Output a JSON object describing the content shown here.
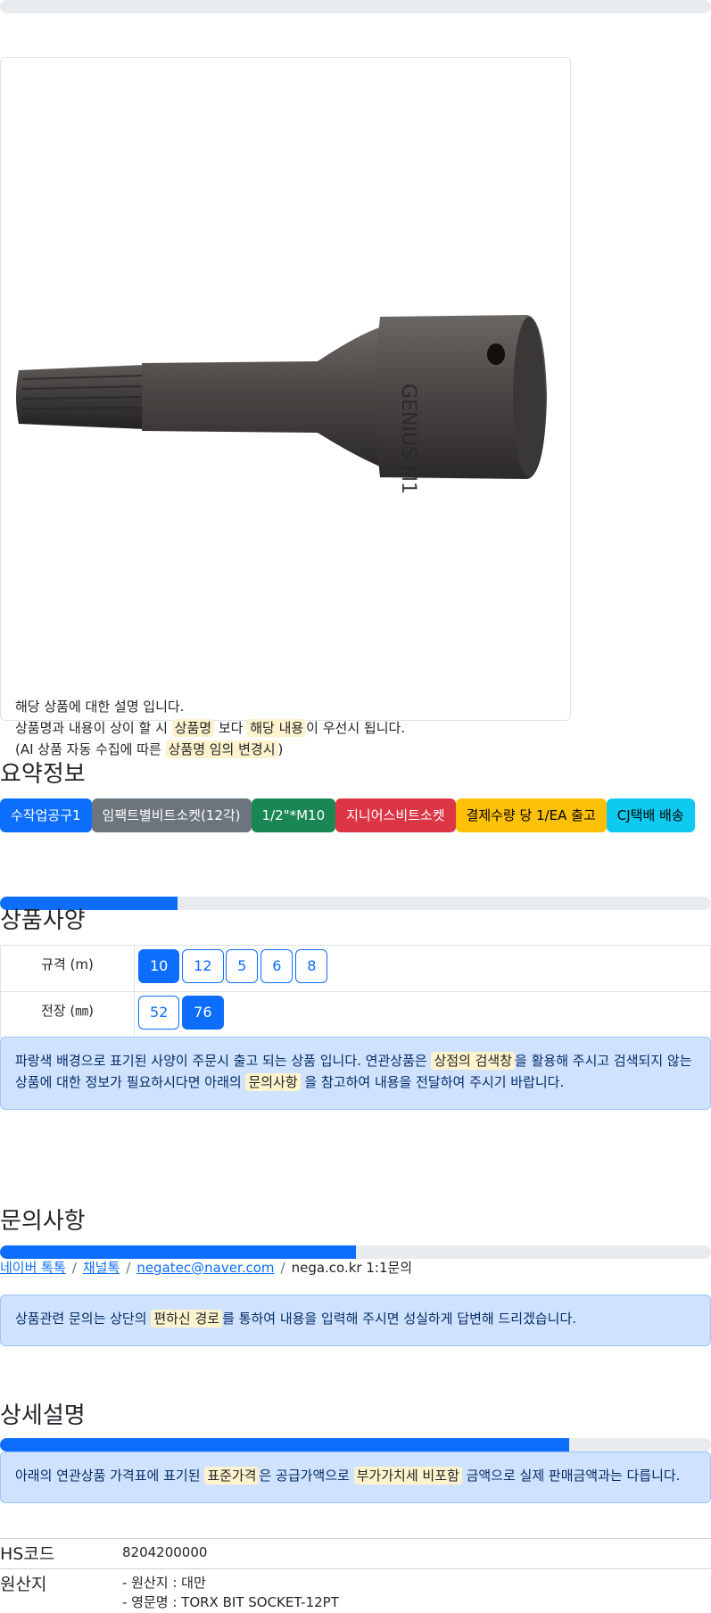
{
  "product": {
    "description_lines": [
      {
        "parts": [
          {
            "text": "해당 상품에 대한 설명 입니다."
          }
        ]
      },
      {
        "parts": [
          {
            "text": "상품명과 내용이 상이 할 시 "
          },
          {
            "text": "상품명",
            "hl": true
          },
          {
            "text": " 보다 "
          },
          {
            "text": "해당 내용",
            "hl": true
          },
          {
            "text": "이 우선시 됩니다."
          }
        ]
      },
      {
        "parts": [
          {
            "text": "(AI 상품 자동 수집에 따른 "
          },
          {
            "text": "상품명 임의 변경시",
            "hl": true
          },
          {
            "text": ")"
          }
        ]
      }
    ]
  },
  "summary": {
    "title": "요약정보",
    "badges": [
      {
        "label": "수작업공구1",
        "bg": "#0d6efd",
        "fg": "#ffffff"
      },
      {
        "label": "임팩트별비트소켓(12각)",
        "bg": "#6c757d",
        "fg": "#ffffff"
      },
      {
        "label": "1/2\"*M10",
        "bg": "#198754",
        "fg": "#ffffff"
      },
      {
        "label": "지니어스비트소켓",
        "bg": "#dc3545",
        "fg": "#ffffff"
      },
      {
        "label": "결제수량 당 1/EA 출고",
        "bg": "#ffc107",
        "fg": "#000000"
      },
      {
        "label": "CJ택배 배송",
        "bg": "#0dcaf0",
        "fg": "#000000"
      }
    ]
  },
  "progress": {
    "spec": 0.25,
    "inquiry": 0.5,
    "detail": 0.8
  },
  "spec": {
    "title": "상품사양",
    "rows": [
      {
        "label": "규격 (m)",
        "options": [
          {
            "v": "10",
            "active": true
          },
          {
            "v": "12"
          },
          {
            "v": "5"
          },
          {
            "v": "6"
          },
          {
            "v": "8"
          }
        ]
      },
      {
        "label": "전장 (㎜)",
        "options": [
          {
            "v": "52"
          },
          {
            "v": "76",
            "active": true
          }
        ]
      }
    ],
    "notice": [
      {
        "text": "파랑색 배경으로 표기된 사양이 주문시 출고 되는 상품 입니다. 연관상품은 "
      },
      {
        "text": "상점의 검색창",
        "hl": true
      },
      {
        "text": "을 활용해 주시고 검색되지 않는 상품에 대한 정보가 필요하시다면 아래의 "
      },
      {
        "text": "문의사항",
        "hl": true
      },
      {
        "text": " 을 참고하여 내용을 전달하여 주시기 바랍니다."
      }
    ]
  },
  "inquiry": {
    "title": "문의사항",
    "links": [
      {
        "label": "네이버 톡톡",
        "link": true
      },
      {
        "label": "채널톡",
        "link": true
      },
      {
        "label": "negatec@naver.com",
        "link": true
      },
      {
        "label": "nega.co.kr 1:1문의",
        "link": false
      }
    ],
    "notice": [
      {
        "text": "상품관련 문의는 상단의 "
      },
      {
        "text": "편하신 경로",
        "hl": true
      },
      {
        "text": "를 통하여 내용을 입력해 주시면 성실하게 답변해 드리겠습니다."
      }
    ]
  },
  "detail": {
    "title": "상세설명",
    "notice": [
      {
        "text": "아래의 연관상품 가격표에 표기된 "
      },
      {
        "text": "표준가격",
        "hl": true
      },
      {
        "text": "은 공급가액으로 "
      },
      {
        "text": "부가가치세 비포함",
        "hl": true
      },
      {
        "text": " 금액으로 실제 판매금액과는 다릅니다."
      }
    ],
    "hs_label": "HS코드",
    "hs_value": "8204200000",
    "origin_label": "원산지",
    "origin_lines": [
      "- 원산지 : 대만",
      "- 영문명 : TORX BIT SOCKET-12PT"
    ]
  }
}
